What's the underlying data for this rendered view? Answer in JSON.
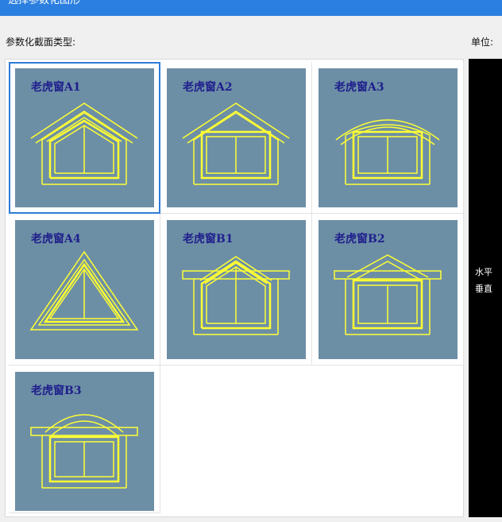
{
  "window": {
    "title": "选择参数化图形"
  },
  "section_label": "参数化截面类型:",
  "unit_label": "单位:",
  "preview": {
    "horizontal_label": "水平",
    "vertical_label": "垂直"
  },
  "thumbnails": [
    {
      "title": "老虎窗A1",
      "selected": true
    },
    {
      "title": "老虎窗A2",
      "selected": false
    },
    {
      "title": "老虎窗A3",
      "selected": false
    },
    {
      "title": "老虎窗A4",
      "selected": false
    },
    {
      "title": "老虎窗B1",
      "selected": false
    },
    {
      "title": "老虎窗B2",
      "selected": false
    },
    {
      "title": "老虎窗B3",
      "selected": false
    }
  ],
  "colors": {
    "title_bar": "#2b7fe0",
    "thumb_bg": "#6d8fa6",
    "line": "#ffff33",
    "title_text": "#1f1f8c",
    "selection": "#2e7bd6"
  }
}
